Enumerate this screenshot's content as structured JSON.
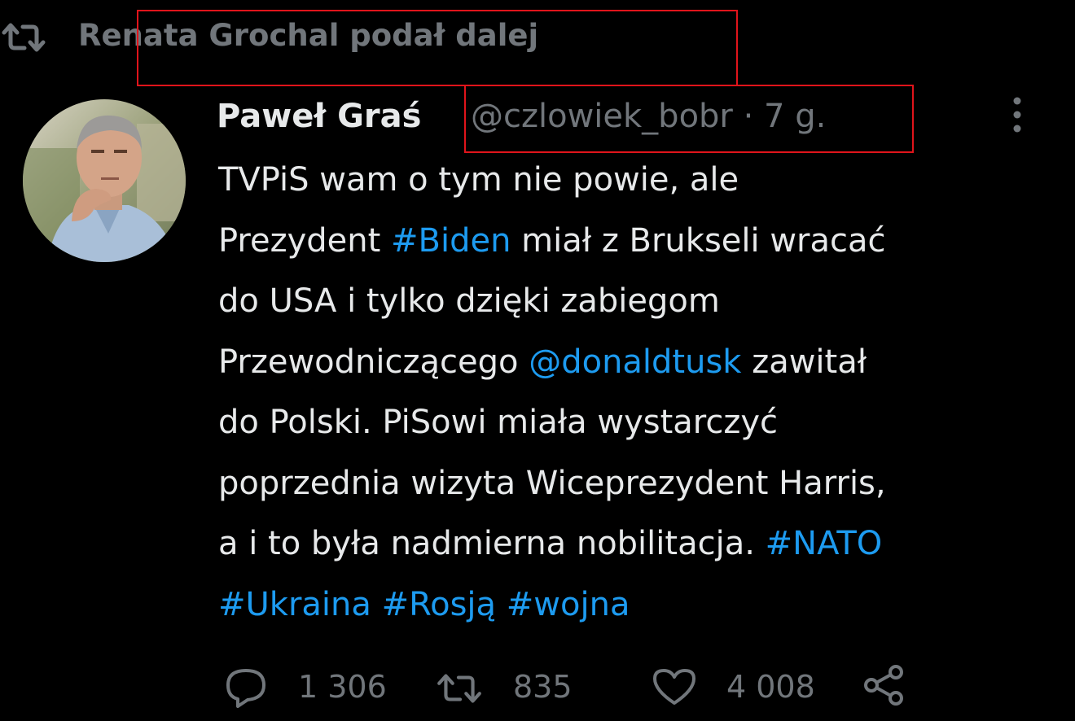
{
  "retweet_banner": {
    "icon": "retweet-icon",
    "text": "Renata Grochal podał dalej"
  },
  "tweet": {
    "author": {
      "display_name": "Paweł Graś",
      "handle": "@czlowiek_bobr",
      "separator": "·",
      "time": "7 g.",
      "avatar": "profile-photo"
    },
    "more_icon": "more-options-icon",
    "text_lines": [
      [
        {
          "t": "TVPiS wam o tym nie powie, ale",
          "link": false
        }
      ],
      [
        {
          "t": "Prezydent ",
          "link": false
        },
        {
          "t": "#Biden",
          "link": true
        },
        {
          "t": " miał z Brukseli wracać",
          "link": false
        }
      ],
      [
        {
          "t": "do USA i tylko dzięki zabiegom",
          "link": false
        }
      ],
      [
        {
          "t": "Przewodniczącego ",
          "link": false
        },
        {
          "t": "@donaldtusk",
          "link": true
        },
        {
          "t": " zawitał",
          "link": false
        }
      ],
      [
        {
          "t": "do Polski. PiSowi miała wystarczyć",
          "link": false
        }
      ],
      [
        {
          "t": "poprzednia wizyta Wiceprezydent Harris,",
          "link": false
        }
      ],
      [
        {
          "t": "a i to była nadmierna nobilitacja. ",
          "link": false
        },
        {
          "t": "#NATO",
          "link": true
        }
      ],
      [
        {
          "t": "#Ukraina",
          "link": true
        },
        {
          "t": " ",
          "link": false
        },
        {
          "t": "#Rosją",
          "link": true
        },
        {
          "t": " ",
          "link": false
        },
        {
          "t": "#wojna",
          "link": true
        }
      ]
    ],
    "actions": {
      "replies": {
        "icon": "reply-icon",
        "count": "1 306"
      },
      "retweets": {
        "icon": "retweet-icon",
        "count": "835"
      },
      "likes": {
        "icon": "heart-icon",
        "count": "4 008"
      },
      "share": {
        "icon": "share-icon"
      }
    }
  },
  "colors": {
    "background": "#000000",
    "primary_text": "#e7e9ea",
    "secondary_text": "#71767b",
    "link": "#1d9bf0",
    "annotation_box": "#e0141b"
  }
}
